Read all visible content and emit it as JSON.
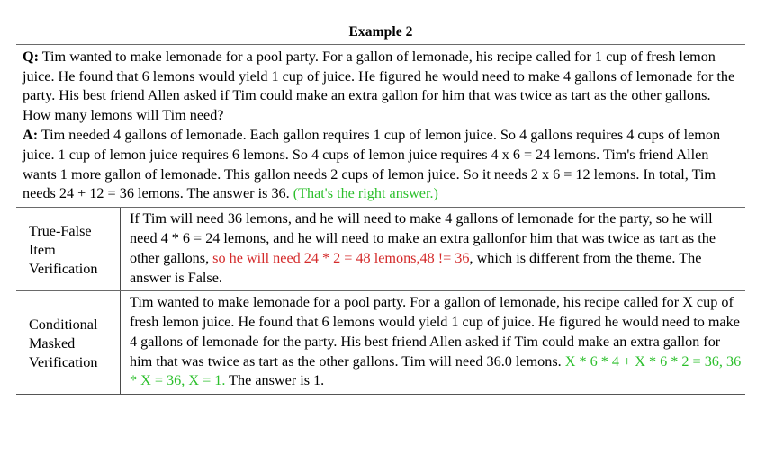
{
  "title": "Example 2",
  "qa": {
    "question_prefix": "Q:",
    "question": " Tim wanted to make lemonade for a pool party. For a gallon of lemonade, his recipe called for 1 cup of fresh lemon juice. He found that 6 lemons would yield 1 cup of juice. He figured he would need to make 4 gallons of lemonade for the party. His best friend Allen asked if Tim could make an extra gallon for him that was twice as tart as the other gallons. How many lemons will Tim need?",
    "answer_prefix": "A:",
    "answer": " Tim needed 4 gallons of lemonade. Each gallon requires 1 cup of lemon juice. So 4 gallons requires 4 cups of lemon juice. 1 cup of lemon juice requires 6 lemons. So 4 cups of lemon juice requires 4 x 6 = 24 lemons. Tim's friend Allen wants 1 more gallon of lemonade. This gallon needs 2 cups of lemon juice. So it needs 2 x 6 = 12 lemons. In total, Tim needs 24 + 12 = 36 lemons. The answer is 36. ",
    "answer_highlight": "(That's the right answer.)"
  },
  "rows": [
    {
      "label_lines": [
        "True-False",
        "Item",
        "Verification"
      ],
      "text_before": "If Tim will need 36 lemons, and he will need to make 4 gallons of lemonade for the party, so he will need 4 * 6 = 24 lemons, and he will need to make an extra gallonfor him that was twice as tart as the other gallons, ",
      "text_highlight": "so he will need 24 * 2 = 48 lemons,48 != 36",
      "highlight_color": "red",
      "text_after": ", which is different from the theme. The answer is False."
    },
    {
      "label_lines": [
        "Conditional",
        "Masked",
        "Verification"
      ],
      "text_before": "Tim wanted to make lemonade for a pool party. For a gallon of lemonade, his recipe called for X cup of fresh lemon juice. He found that 6 lemons would yield 1 cup of juice. He figured he would need to make 4 gallons of lemonade for the party. His best friend Allen asked if Tim could make an extra gallon for him that was twice as tart as the other gallons. Tim will need 36.0 lemons. ",
      "text_highlight": "X * 6 * 4 + X * 6 * 2 = 36, 36 * X = 36, X = 1.",
      "highlight_color": "green",
      "text_after": " The answer is 1."
    }
  ],
  "colors": {
    "green": "#2bbf2b",
    "red": "#d42a2a",
    "rule": "#555555",
    "text": "#000000"
  }
}
